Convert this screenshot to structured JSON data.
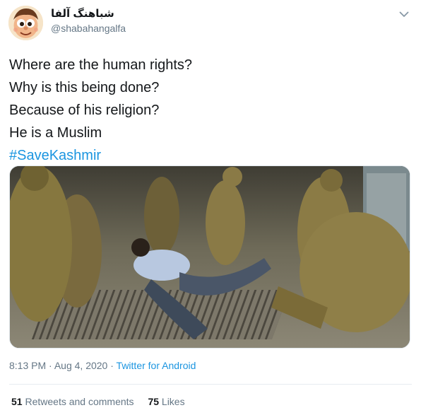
{
  "author": {
    "display_name": "شباهنگ آلفا",
    "handle": "@shabahangalfa"
  },
  "icons": {
    "menu": "chevron-down-icon"
  },
  "tweet": {
    "lines": [
      "Where are the human rights?",
      "Why is this being done?",
      "Because of his religion?",
      "He is a Muslim"
    ],
    "hashtag": "#SaveKashmir"
  },
  "meta": {
    "time": "8:13 PM",
    "date": "Aug 4, 2020",
    "separator": "·",
    "source": "Twitter for Android"
  },
  "stats": {
    "retweets_count": "51",
    "retweets_label": "Retweets and comments",
    "likes_count": "75",
    "likes_label": "Likes"
  },
  "colors": {
    "link": "#1b95e0",
    "secondary_text": "#657786",
    "primary_text": "#14171a"
  }
}
